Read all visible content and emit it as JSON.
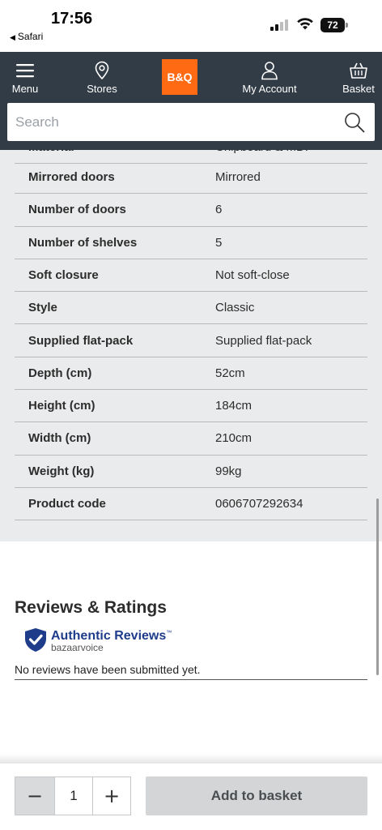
{
  "status_bar": {
    "time": "17:56",
    "back_app": "Safari",
    "battery": "72"
  },
  "nav": {
    "menu_label": "Menu",
    "stores_label": "Stores",
    "logo_text": "B&Q",
    "account_label": "My Account",
    "basket_label": "Basket"
  },
  "search": {
    "placeholder": "Search"
  },
  "specs": {
    "partial_row": {
      "key": "Material",
      "value": "Chipboard & MDF"
    },
    "rows": [
      {
        "key": "Mirrored doors",
        "value": "Mirrored"
      },
      {
        "key": "Number of doors",
        "value": "6"
      },
      {
        "key": "Number of shelves",
        "value": "5"
      },
      {
        "key": "Soft closure",
        "value": "Not soft-close"
      },
      {
        "key": "Style",
        "value": "Classic"
      },
      {
        "key": "Supplied flat-pack",
        "value": "Supplied flat-pack"
      },
      {
        "key": "Depth (cm)",
        "value": "52cm"
      },
      {
        "key": "Height (cm)",
        "value": "184cm"
      },
      {
        "key": "Width (cm)",
        "value": "210cm"
      },
      {
        "key": "Weight (kg)",
        "value": "99kg"
      },
      {
        "key": "Product code",
        "value": "0606707292634"
      }
    ]
  },
  "reviews": {
    "title": "Reviews & Ratings",
    "badge_title": "Authentic Reviews",
    "badge_tm": "™",
    "badge_sub": "bazaarvoice",
    "empty_text": "No reviews have been submitted yet."
  },
  "basket_bar": {
    "quantity": "1",
    "minus": "−",
    "plus": "+",
    "add_label": "Add to basket"
  },
  "colors": {
    "header_bg": "#323c46",
    "brand_orange": "#ff6a13",
    "specs_bg": "#eaebec",
    "badge_blue": "#1f3c8a"
  }
}
